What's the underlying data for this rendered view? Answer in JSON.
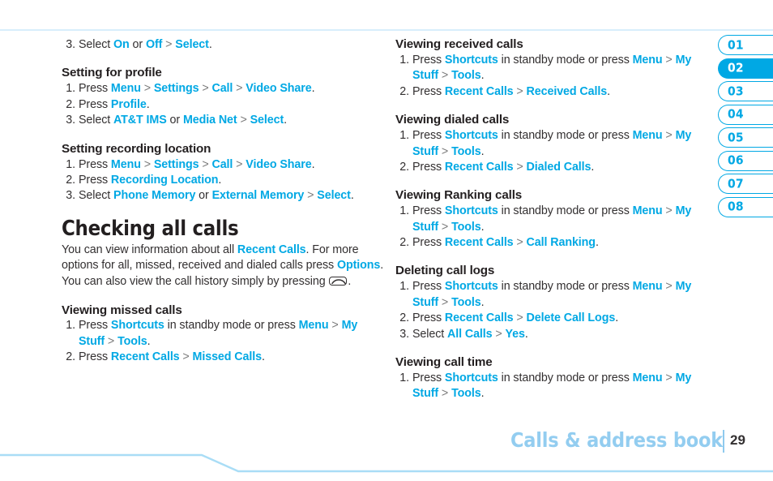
{
  "colors": {
    "accent": "#00a8e4",
    "footer_title": "#93cdf0",
    "rule": "#bfe6f8",
    "text": "#333031"
  },
  "tabs": {
    "items": [
      {
        "label": "01",
        "active": false
      },
      {
        "label": "02",
        "active": true
      },
      {
        "label": "03",
        "active": false
      },
      {
        "label": "04",
        "active": false
      },
      {
        "label": "05",
        "active": false
      },
      {
        "label": "06",
        "active": false
      },
      {
        "label": "07",
        "active": false
      },
      {
        "label": "08",
        "active": false
      }
    ]
  },
  "footer": {
    "title": "Calls & address book",
    "page_number": "29"
  },
  "left_column": {
    "orphan_step": {
      "num": "3.",
      "parts": [
        {
          "t": "Select ",
          "s": "plain"
        },
        {
          "t": "On",
          "s": "key"
        },
        {
          "t": " or ",
          "s": "plain"
        },
        {
          "t": "Off",
          "s": "key"
        },
        {
          "t": " > ",
          "s": "sep"
        },
        {
          "t": "Select",
          "s": "key"
        },
        {
          "t": ".",
          "s": "plain"
        }
      ]
    },
    "sections": [
      {
        "heading": "Setting for profile",
        "steps": [
          {
            "num": "1.",
            "parts": [
              {
                "t": "Press ",
                "s": "plain"
              },
              {
                "t": "Menu",
                "s": "key"
              },
              {
                "t": " > ",
                "s": "sep"
              },
              {
                "t": "Settings",
                "s": "key"
              },
              {
                "t": " > ",
                "s": "sep"
              },
              {
                "t": "Call",
                "s": "key"
              },
              {
                "t": " > ",
                "s": "sep"
              },
              {
                "t": "Video Share",
                "s": "key"
              },
              {
                "t": ".",
                "s": "plain"
              }
            ]
          },
          {
            "num": "2.",
            "parts": [
              {
                "t": "Press ",
                "s": "plain"
              },
              {
                "t": "Profile",
                "s": "key"
              },
              {
                "t": ".",
                "s": "plain"
              }
            ]
          },
          {
            "num": "3.",
            "parts": [
              {
                "t": "Select ",
                "s": "plain"
              },
              {
                "t": "AT&T IMS",
                "s": "key"
              },
              {
                "t": " or ",
                "s": "plain"
              },
              {
                "t": "Media Net",
                "s": "key"
              },
              {
                "t": " > ",
                "s": "sep"
              },
              {
                "t": "Select",
                "s": "key"
              },
              {
                "t": ".",
                "s": "plain"
              }
            ]
          }
        ]
      },
      {
        "heading": "Setting recording location",
        "steps": [
          {
            "num": "1.",
            "parts": [
              {
                "t": "Press ",
                "s": "plain"
              },
              {
                "t": "Menu",
                "s": "key"
              },
              {
                "t": " > ",
                "s": "sep"
              },
              {
                "t": "Settings",
                "s": "key"
              },
              {
                "t": " > ",
                "s": "sep"
              },
              {
                "t": "Call",
                "s": "key"
              },
              {
                "t": " > ",
                "s": "sep"
              },
              {
                "t": "Video Share",
                "s": "key"
              },
              {
                "t": ".",
                "s": "plain"
              }
            ]
          },
          {
            "num": "2.",
            "parts": [
              {
                "t": "Press ",
                "s": "plain"
              },
              {
                "t": "Recording Location",
                "s": "key"
              },
              {
                "t": ".",
                "s": "plain"
              }
            ]
          },
          {
            "num": "3.",
            "parts": [
              {
                "t": "Select ",
                "s": "plain"
              },
              {
                "t": "Phone Memory",
                "s": "key"
              },
              {
                "t": " or ",
                "s": "plain"
              },
              {
                "t": "External Memory",
                "s": "key"
              },
              {
                "t": " > ",
                "s": "sep"
              },
              {
                "t": "Select",
                "s": "key"
              },
              {
                "t": ".",
                "s": "plain"
              }
            ]
          }
        ]
      }
    ],
    "chapter_heading": "Checking all calls",
    "intro_paragraph": [
      {
        "t": "You can view information about all ",
        "s": "plain"
      },
      {
        "t": "Recent Calls",
        "s": "key"
      },
      {
        "t": ". For more options for all, missed, received and dialed calls press ",
        "s": "plain"
      },
      {
        "t": "Options",
        "s": "key"
      },
      {
        "t": ". You can also view the call history simply by pressing ",
        "s": "plain"
      },
      {
        "t": "send-key-icon",
        "s": "icon"
      },
      {
        "t": ".",
        "s": "plain"
      }
    ],
    "last_section": {
      "heading": "Viewing missed calls",
      "steps": [
        {
          "num": "1.",
          "parts": [
            {
              "t": "Press ",
              "s": "plain"
            },
            {
              "t": "Shortcuts",
              "s": "key"
            },
            {
              "t": " in standby mode or press ",
              "s": "plain"
            },
            {
              "t": "Menu",
              "s": "key"
            },
            {
              "t": " > ",
              "s": "sep"
            },
            {
              "t": "My Stuff",
              "s": "key"
            },
            {
              "t": " > ",
              "s": "sep"
            },
            {
              "t": "Tools",
              "s": "key"
            },
            {
              "t": ".",
              "s": "plain"
            }
          ]
        },
        {
          "num": "2.",
          "parts": [
            {
              "t": "Press ",
              "s": "plain"
            },
            {
              "t": "Recent Calls",
              "s": "key"
            },
            {
              "t": " > ",
              "s": "sep"
            },
            {
              "t": "Missed Calls",
              "s": "key"
            },
            {
              "t": ".",
              "s": "plain"
            }
          ]
        }
      ]
    }
  },
  "right_column": {
    "sections": [
      {
        "heading": "Viewing received calls",
        "steps": [
          {
            "num": "1.",
            "parts": [
              {
                "t": "Press ",
                "s": "plain"
              },
              {
                "t": "Shortcuts",
                "s": "key"
              },
              {
                "t": " in standby mode or press ",
                "s": "plain"
              },
              {
                "t": "Menu",
                "s": "key"
              },
              {
                "t": " > ",
                "s": "sep"
              },
              {
                "t": "My Stuff",
                "s": "key"
              },
              {
                "t": " > ",
                "s": "sep"
              },
              {
                "t": "Tools",
                "s": "key"
              },
              {
                "t": ".",
                "s": "plain"
              }
            ]
          },
          {
            "num": "2.",
            "parts": [
              {
                "t": "Press ",
                "s": "plain"
              },
              {
                "t": "Recent Calls",
                "s": "key"
              },
              {
                "t": " > ",
                "s": "sep"
              },
              {
                "t": "Received Calls",
                "s": "key"
              },
              {
                "t": ".",
                "s": "plain"
              }
            ]
          }
        ]
      },
      {
        "heading": "Viewing dialed calls",
        "steps": [
          {
            "num": "1.",
            "parts": [
              {
                "t": "Press ",
                "s": "plain"
              },
              {
                "t": "Shortcuts",
                "s": "key"
              },
              {
                "t": " in standby mode or press ",
                "s": "plain"
              },
              {
                "t": "Menu",
                "s": "key"
              },
              {
                "t": " > ",
                "s": "sep"
              },
              {
                "t": "My Stuff",
                "s": "key"
              },
              {
                "t": " > ",
                "s": "sep"
              },
              {
                "t": "Tools",
                "s": "key"
              },
              {
                "t": ".",
                "s": "plain"
              }
            ]
          },
          {
            "num": "2.",
            "parts": [
              {
                "t": "Press ",
                "s": "plain"
              },
              {
                "t": "Recent Calls",
                "s": "key"
              },
              {
                "t": " > ",
                "s": "sep"
              },
              {
                "t": "Dialed Calls",
                "s": "key"
              },
              {
                "t": ".",
                "s": "plain"
              }
            ]
          }
        ]
      },
      {
        "heading": "Viewing Ranking calls",
        "steps": [
          {
            "num": "1.",
            "parts": [
              {
                "t": "Press ",
                "s": "plain"
              },
              {
                "t": "Shortcuts",
                "s": "key"
              },
              {
                "t": " in standby mode or press ",
                "s": "plain"
              },
              {
                "t": "Menu",
                "s": "key"
              },
              {
                "t": " > ",
                "s": "sep"
              },
              {
                "t": "My Stuff",
                "s": "key"
              },
              {
                "t": " > ",
                "s": "sep"
              },
              {
                "t": "Tools",
                "s": "key"
              },
              {
                "t": ".",
                "s": "plain"
              }
            ]
          },
          {
            "num": "2.",
            "parts": [
              {
                "t": "Press ",
                "s": "plain"
              },
              {
                "t": "Recent Calls",
                "s": "key"
              },
              {
                "t": " > ",
                "s": "sep"
              },
              {
                "t": "Call Ranking",
                "s": "key"
              },
              {
                "t": ".",
                "s": "plain"
              }
            ]
          }
        ]
      },
      {
        "heading": "Deleting call logs",
        "steps": [
          {
            "num": "1.",
            "parts": [
              {
                "t": "Press ",
                "s": "plain"
              },
              {
                "t": "Shortcuts",
                "s": "key"
              },
              {
                "t": " in standby mode or press ",
                "s": "plain"
              },
              {
                "t": "Menu",
                "s": "key"
              },
              {
                "t": " > ",
                "s": "sep"
              },
              {
                "t": "My Stuff",
                "s": "key"
              },
              {
                "t": " > ",
                "s": "sep"
              },
              {
                "t": "Tools",
                "s": "key"
              },
              {
                "t": ".",
                "s": "plain"
              }
            ]
          },
          {
            "num": "2.",
            "parts": [
              {
                "t": "Press ",
                "s": "plain"
              },
              {
                "t": "Recent Calls",
                "s": "key"
              },
              {
                "t": " > ",
                "s": "sep"
              },
              {
                "t": "Delete Call Logs",
                "s": "key"
              },
              {
                "t": ".",
                "s": "plain"
              }
            ]
          },
          {
            "num": "3.",
            "parts": [
              {
                "t": "Select ",
                "s": "plain"
              },
              {
                "t": "All Calls",
                "s": "key"
              },
              {
                "t": " > ",
                "s": "sep"
              },
              {
                "t": "Yes",
                "s": "key"
              },
              {
                "t": ".",
                "s": "plain"
              }
            ]
          }
        ]
      },
      {
        "heading": "Viewing call time",
        "steps": [
          {
            "num": "1.",
            "parts": [
              {
                "t": "Press ",
                "s": "plain"
              },
              {
                "t": "Shortcuts",
                "s": "key"
              },
              {
                "t": " in standby mode or press ",
                "s": "plain"
              },
              {
                "t": "Menu",
                "s": "key"
              },
              {
                "t": " > ",
                "s": "sep"
              },
              {
                "t": "My Stuff",
                "s": "key"
              },
              {
                "t": " > ",
                "s": "sep"
              },
              {
                "t": "Tools",
                "s": "key"
              },
              {
                "t": ".",
                "s": "plain"
              }
            ]
          }
        ]
      }
    ]
  }
}
